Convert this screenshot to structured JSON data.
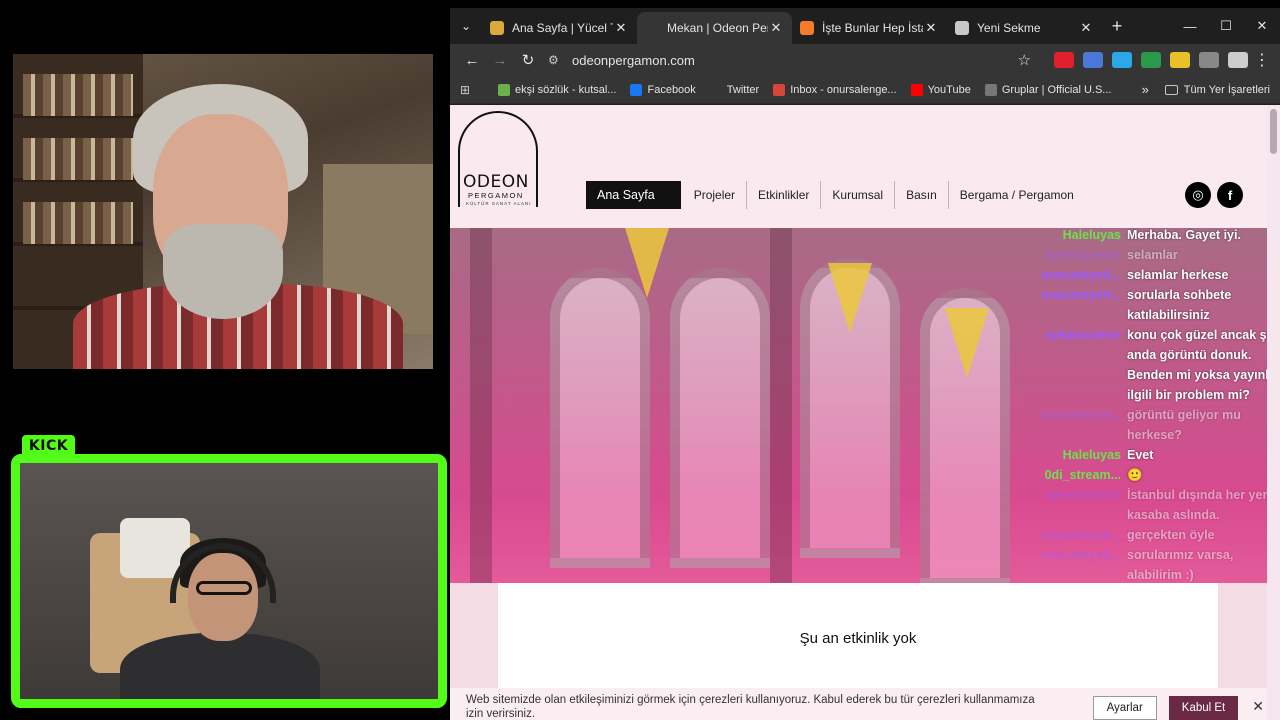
{
  "overlay": {
    "kick_label": "KICK"
  },
  "browser": {
    "tabs": [
      {
        "title": "Ana Sayfa | Yücel Tunca",
        "favicon": "y-icon",
        "favicon_color": "#d9a93a",
        "active": false
      },
      {
        "title": "Mekan | Odeon Pergamon",
        "favicon": "none",
        "favicon_color": "",
        "active": true
      },
      {
        "title": "İşte Bunlar Hep İstanbul",
        "favicon": "blogger-icon",
        "favicon_color": "#f57c2a",
        "active": false
      },
      {
        "title": "Yeni Sekme",
        "favicon": "chrome-icon",
        "favicon_color": "#c8c8c8",
        "active": false
      }
    ],
    "url": "odeonpergamon.com",
    "bookmarks": [
      {
        "label": "ekşi sözlük - kutsal...",
        "icon": "eksi-icon",
        "color": "#6ab04c"
      },
      {
        "label": "Facebook",
        "icon": "facebook-icon",
        "color": "#1877f2"
      },
      {
        "label": "Twitter",
        "icon": "x-icon",
        "color": "#353535"
      },
      {
        "label": "Inbox - onursalenge...",
        "icon": "gmail-icon",
        "color": "#d44638"
      },
      {
        "label": "YouTube",
        "icon": "youtube-icon",
        "color": "#ff0000"
      },
      {
        "label": "Gruplar | Official U.S...",
        "icon": "link-icon",
        "color": "#777777"
      }
    ],
    "all_bookmarks_label": "Tüm Yer İşaretleri",
    "extensions": [
      "#e0202a",
      "#4a78d8",
      "#2aa8e8",
      "#2a9a4a",
      "#e8c02a",
      "#888888",
      "#cccccc"
    ]
  },
  "site": {
    "logo": {
      "main": "ODEON",
      "sub": "PERGAMON",
      "tag": "KÜLTÜR SANAT ALANI"
    },
    "nav": [
      {
        "label": "Ana Sayfa",
        "active": true
      },
      {
        "label": "Projeler",
        "active": false
      },
      {
        "label": "Etkinlikler",
        "active": false
      },
      {
        "label": "Kurumsal",
        "active": false
      },
      {
        "label": "Basın",
        "active": false
      },
      {
        "label": "Bergama / Pergamon",
        "active": false
      }
    ],
    "socials": [
      {
        "icon": "instagram-icon",
        "glyph": "◎"
      },
      {
        "icon": "facebook-icon",
        "glyph": "f"
      }
    ],
    "event_text": "Şu an etkinlik yok",
    "cookie": {
      "text": "Web sitemizde olan etkileşiminizi görmek için çerezleri kullanıyoruz. Kabul ederek bu tür çerezleri kullanmamıza izin verirsiniz.",
      "settings": "Ayarlar",
      "accept": "Kabul Et",
      "close": "✕"
    }
  },
  "chat": [
    {
      "user": "Haleluyas",
      "msg": "Merhaba. Gayet iyi.",
      "color": "green",
      "faded": false
    },
    {
      "user": "aykanozener",
      "msg": "selamlar",
      "color": "purple",
      "faded": true
    },
    {
      "user": "masumiyeti...",
      "msg": "selamlar herkese",
      "color": "purple",
      "faded": false
    },
    {
      "user": "masumiyeti...",
      "msg": "sorularla sohbete katılabilirsiniz",
      "color": "purple",
      "faded": false
    },
    {
      "user": "aykanozener",
      "msg": "konu çok güzel ancak şu anda görüntü donuk. Benden mi yoksa yayınla ilgili bir problem mi?",
      "color": "purple",
      "faded": false
    },
    {
      "user": "masumiyeti...",
      "msg": "görüntü geliyor mu herkese?",
      "color": "purple",
      "faded": true
    },
    {
      "user": "Haleluyas",
      "msg": "Evet",
      "color": "green",
      "faded": false
    },
    {
      "user": "0di_stream...",
      "msg": "🙂",
      "color": "green",
      "faded": false
    },
    {
      "user": "aykanozener",
      "msg": "İstanbul dışında her yer kasaba aslında.",
      "color": "purple",
      "faded": true
    },
    {
      "user": "masumiyeti...",
      "msg": "gerçekten öyle",
      "color": "purple",
      "faded": true
    },
    {
      "user": "masumiyeti...",
      "msg": "sorularımız varsa, alabilirim :)",
      "color": "purple",
      "faded": true
    }
  ]
}
